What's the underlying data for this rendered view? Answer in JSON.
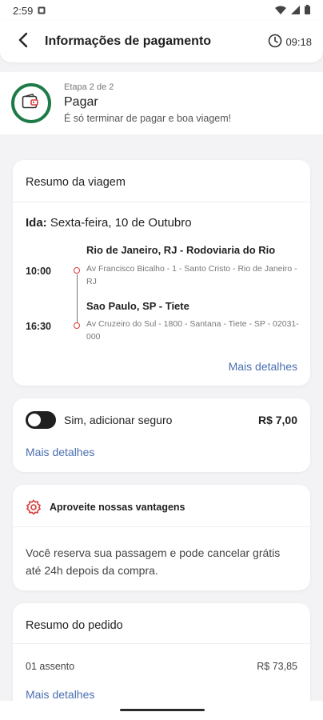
{
  "status_bar": {
    "time": "2:59",
    "icons": [
      "notification-icon",
      "wifi-icon",
      "signal-icon",
      "battery-icon"
    ]
  },
  "header": {
    "title": "Informações de pagamento",
    "timer": "09:18",
    "icons": [
      "back-arrow-icon",
      "clock-icon"
    ]
  },
  "step": {
    "label": "Etapa 2 de 2",
    "title": "Pagar",
    "subtitle": "É só terminar de pagar e boa viagem!",
    "icon": "wallet-icon",
    "ring_color": "#1e7a46"
  },
  "trip_summary": {
    "title": "Resumo da viagem",
    "ida_label": "Ida:",
    "ida_date": " Sexta-feira, 10 de Outubro",
    "departure": {
      "time": "10:00",
      "station": "Rio de Janeiro, RJ - Rodoviaria do Rio",
      "address": "Av Francisco Bicalho - 1 - Santo Cristo - Rio de Janeiro - RJ"
    },
    "arrival": {
      "time": "16:30",
      "station": "Sao Paulo, SP - Tiete",
      "address": "Av Cruzeiro do Sul - 1800 - Santana - Tiete - SP - 02031-000"
    },
    "more_details": "Mais detalhes"
  },
  "insurance": {
    "label": "Sim, adicionar seguro",
    "price": "R$ 7,00",
    "enabled": false,
    "more_details": "Mais detalhes"
  },
  "advantages": {
    "title": "Aproveite nossas vantagens",
    "text": "Você reserva sua passagem e pode cancelar grátis até 24h depois da compra.",
    "icon": "gear-badge-icon"
  },
  "order_summary": {
    "title": "Resumo do pedido",
    "item_label": "01 assento",
    "item_price": "R$ 73,85",
    "more_details": "Mais detalhes"
  },
  "colors": {
    "accent_link": "#4a6fb0",
    "route_dot": "#d93a3a",
    "step_ring": "#1e7a46"
  }
}
